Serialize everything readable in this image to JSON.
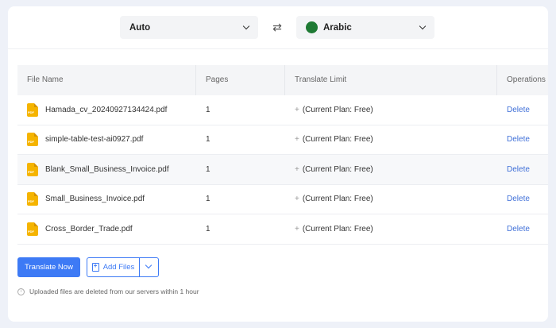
{
  "language_bar": {
    "source": "Auto",
    "target": "Arabic",
    "swap_icon": "swap-arrows-icon"
  },
  "table": {
    "headers": {
      "file_name": "File Name",
      "pages": "Pages",
      "translate_limit": "Translate Limit",
      "operations": "Operations"
    },
    "rows": [
      {
        "file_name": "Hamada_cv_20240927134424.pdf",
        "pages": "1",
        "strike": "+",
        "limit": "(Current Plan: Free)",
        "action": "Delete"
      },
      {
        "file_name": "simple-table-test-ai0927.pdf",
        "pages": "1",
        "strike": "+",
        "limit": "(Current Plan: Free)",
        "action": "Delete"
      },
      {
        "file_name": "Blank_Small_Business_Invoice.pdf",
        "pages": "1",
        "strike": "+",
        "limit": "(Current Plan: Free)",
        "action": "Delete"
      },
      {
        "file_name": "Small_Business_Invoice.pdf",
        "pages": "1",
        "strike": "+",
        "limit": "(Current Plan: Free)",
        "action": "Delete"
      },
      {
        "file_name": "Cross_Border_Trade.pdf",
        "pages": "1",
        "strike": "+",
        "limit": "(Current Plan: Free)",
        "action": "Delete"
      }
    ]
  },
  "actions": {
    "translate_now": "Translate Now",
    "add_files": "Add Files"
  },
  "notice": "Uploaded files are deleted from our servers within 1 hour",
  "colors": {
    "accent": "#3d7af5",
    "file_icon": "#f5b400"
  }
}
